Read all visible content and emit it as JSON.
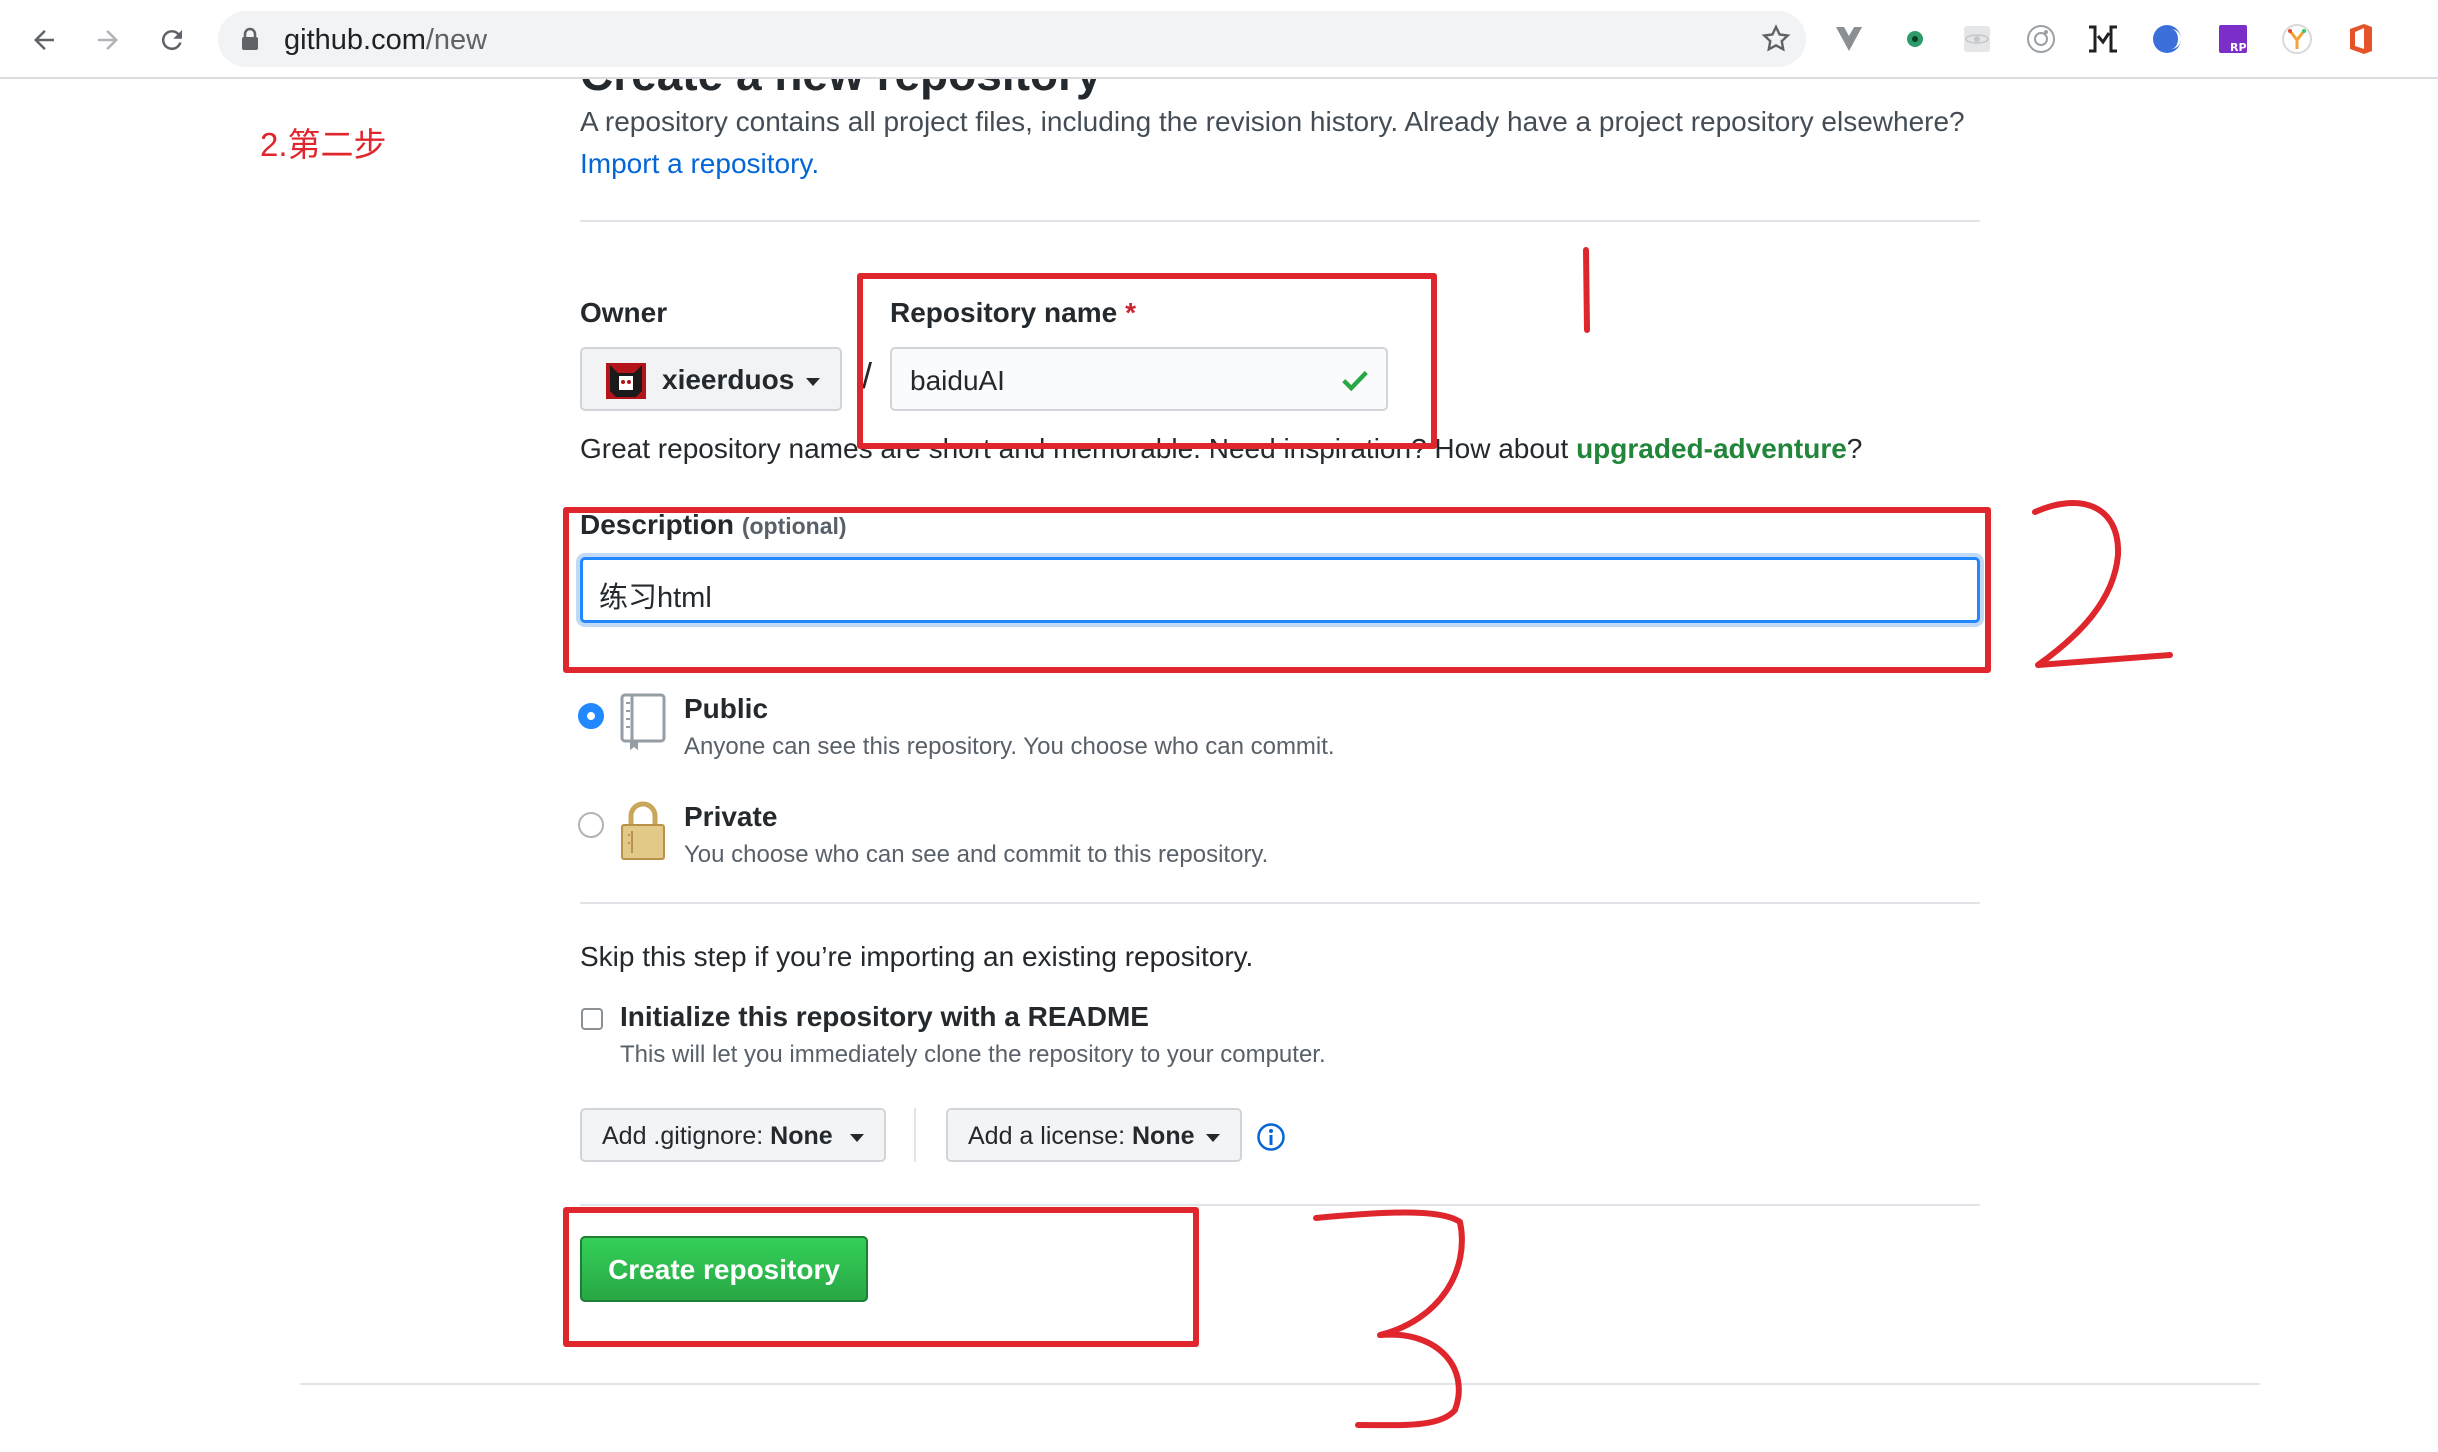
{
  "browser": {
    "url_host": "github.com",
    "url_path": "/new"
  },
  "page": {
    "title": "Create a new repository",
    "intro_text": "A repository contains all project files, including the revision history. Already have a project repository elsewhere?",
    "import_link": "Import a repository.",
    "step_label": "2.第二步"
  },
  "form": {
    "owner_label": "Owner",
    "owner_value": "xieerduos",
    "slash": "/",
    "repo_name_label": "Repository name",
    "required_mark": "*",
    "repo_name_value": "baiduAI",
    "hint_prefix": "Great repository names are short and memorable. Need inspiration? How about",
    "hint_suggestion": "upgraded-adventure",
    "hint_suffix": "?",
    "description_label": "Description",
    "description_optional": "(optional)",
    "description_value": "练习html",
    "visibility": {
      "selected": "public",
      "public_title": "Public",
      "public_desc": "Anyone can see this repository. You choose who can commit.",
      "private_title": "Private",
      "private_desc": "You choose who can see and commit to this repository."
    },
    "skip_text": "Skip this step if you’re importing an existing repository.",
    "readme_checked": false,
    "readme_label": "Initialize this repository with a README",
    "readme_desc": "This will let you immediately clone the repository to your computer.",
    "gitignore_label": "Add .gitignore:",
    "gitignore_value": "None",
    "license_label": "Add a license:",
    "license_value": "None",
    "submit_label": "Create repository"
  },
  "colors": {
    "annotation_red": "#e0262d",
    "primary_green": "#28a745",
    "link_blue": "#0366d6",
    "focus_blue": "#2188ff"
  }
}
